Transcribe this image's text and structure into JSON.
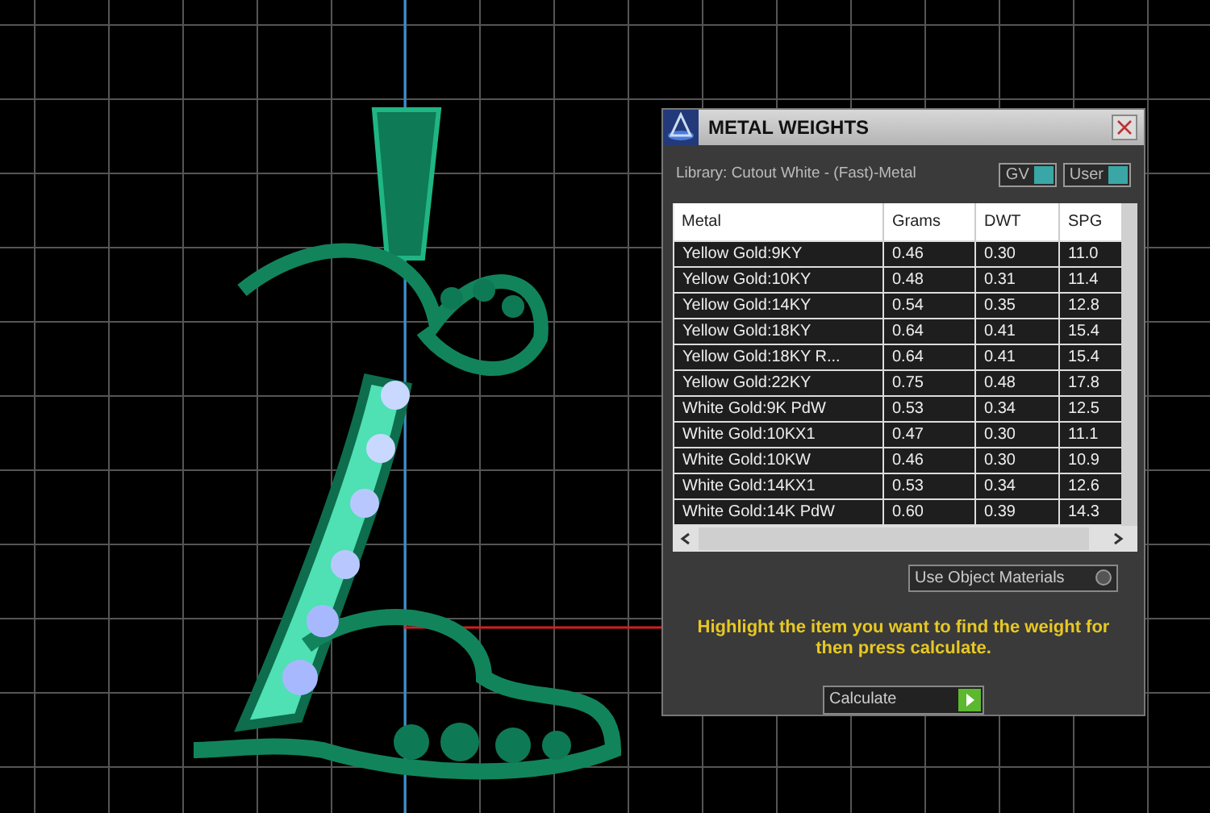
{
  "window": {
    "title": "METAL WEIGHTS"
  },
  "library": "Library: Cutout White - (Fast)-Metal",
  "toggles": [
    {
      "label": "GV",
      "on": true
    },
    {
      "label": "User",
      "on": true
    }
  ],
  "table": {
    "columns": [
      "Metal",
      "Grams",
      "DWT",
      "SPG"
    ],
    "rows": [
      [
        "Yellow Gold:9KY",
        "0.46",
        "0.30",
        "11.0"
      ],
      [
        "Yellow Gold:10KY",
        "0.48",
        "0.31",
        "11.4"
      ],
      [
        "Yellow Gold:14KY",
        "0.54",
        "0.35",
        "12.8"
      ],
      [
        "Yellow Gold:18KY",
        "0.64",
        "0.41",
        "15.4"
      ],
      [
        "Yellow Gold:18KY R...",
        "0.64",
        "0.41",
        "15.4"
      ],
      [
        "Yellow Gold:22KY",
        "0.75",
        "0.48",
        "17.8"
      ],
      [
        "White Gold:9K PdW",
        "0.53",
        "0.34",
        "12.5"
      ],
      [
        "White Gold:10KX1",
        "0.47",
        "0.30",
        "11.1"
      ],
      [
        "White Gold:10KW",
        "0.46",
        "0.30",
        "10.9"
      ],
      [
        "White Gold:14KX1",
        "0.53",
        "0.34",
        "12.6"
      ],
      [
        "White Gold:14K PdW",
        "0.60",
        "0.39",
        "14.3"
      ]
    ]
  },
  "use_object_materials": {
    "label": "Use Object Materials",
    "on": false
  },
  "hint": "Highlight the item you want to find the weight for then press calculate.",
  "calculate_button": "Calculate"
}
